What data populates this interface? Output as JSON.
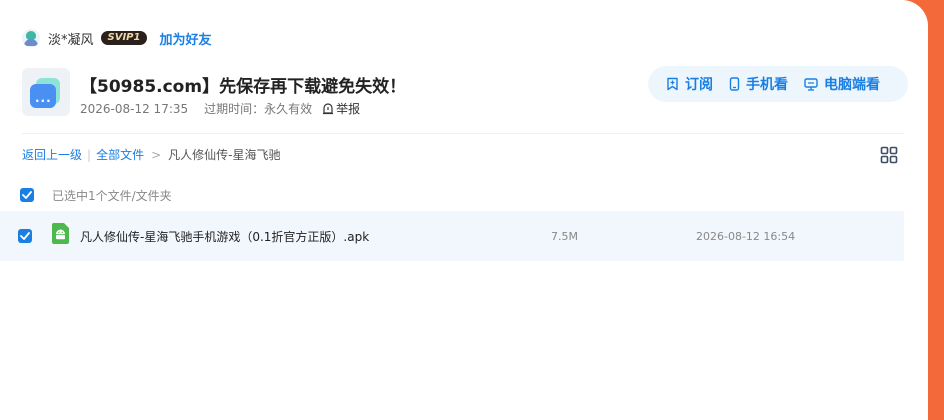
{
  "user": {
    "name": "淡*凝风",
    "vip_badge": "SVIP1",
    "add_friend": "加为好友"
  },
  "share": {
    "title": "【50985.com】先保存再下载避免失效！.…",
    "date": "2026-08-12 17:35",
    "expiry": "过期时间：永久有效",
    "report": "举报"
  },
  "actions": {
    "subscribe": "订阅",
    "mobile": "手机看",
    "desktop": "电脑端看"
  },
  "breadcrumb": {
    "back": "返回上一级",
    "all_files": "全部文件",
    "current": "凡人修仙传-星海飞驰"
  },
  "selection": {
    "text": "已选中1个文件/文件夹"
  },
  "files": [
    {
      "name": "凡人修仙传-星海飞驰手机游戏（0.1折官方正版）.apk",
      "size": "7.5M",
      "date": "2026-08-12 16:54",
      "icon": "android-apk-icon"
    }
  ],
  "colors": {
    "accent": "#1a7fe2",
    "background": "#f4693a",
    "row_highlight": "#f1f7fd"
  }
}
